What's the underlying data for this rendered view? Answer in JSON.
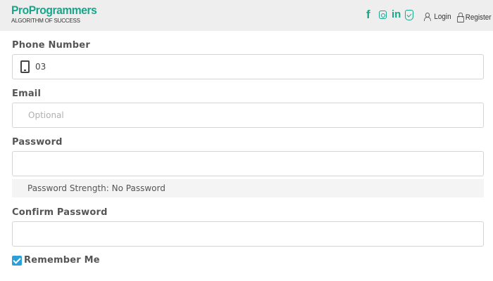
{
  "header": {
    "brand": "ProProgrammers",
    "tagline": "ALGORITHM OF SUCCESS",
    "social_icons": [
      "facebook-icon",
      "instagram-icon",
      "linkedin-icon",
      "shield-check-icon"
    ],
    "login_label": "Login",
    "register_label": "Register"
  },
  "form": {
    "phone_label": "Phone Number",
    "phone_value": "03",
    "email_label": "Email",
    "email_placeholder": "Optional",
    "password_label": "Password",
    "password_value": "",
    "strength_text": "Password Strength: No Password",
    "confirm_label": "Confirm Password",
    "confirm_value": "",
    "remember_label": "Remember Me",
    "remember_checked": true
  },
  "colors": {
    "brand": "#18a589",
    "checkbox": "#2d9fd8",
    "header_bg": "#eeeeee"
  }
}
